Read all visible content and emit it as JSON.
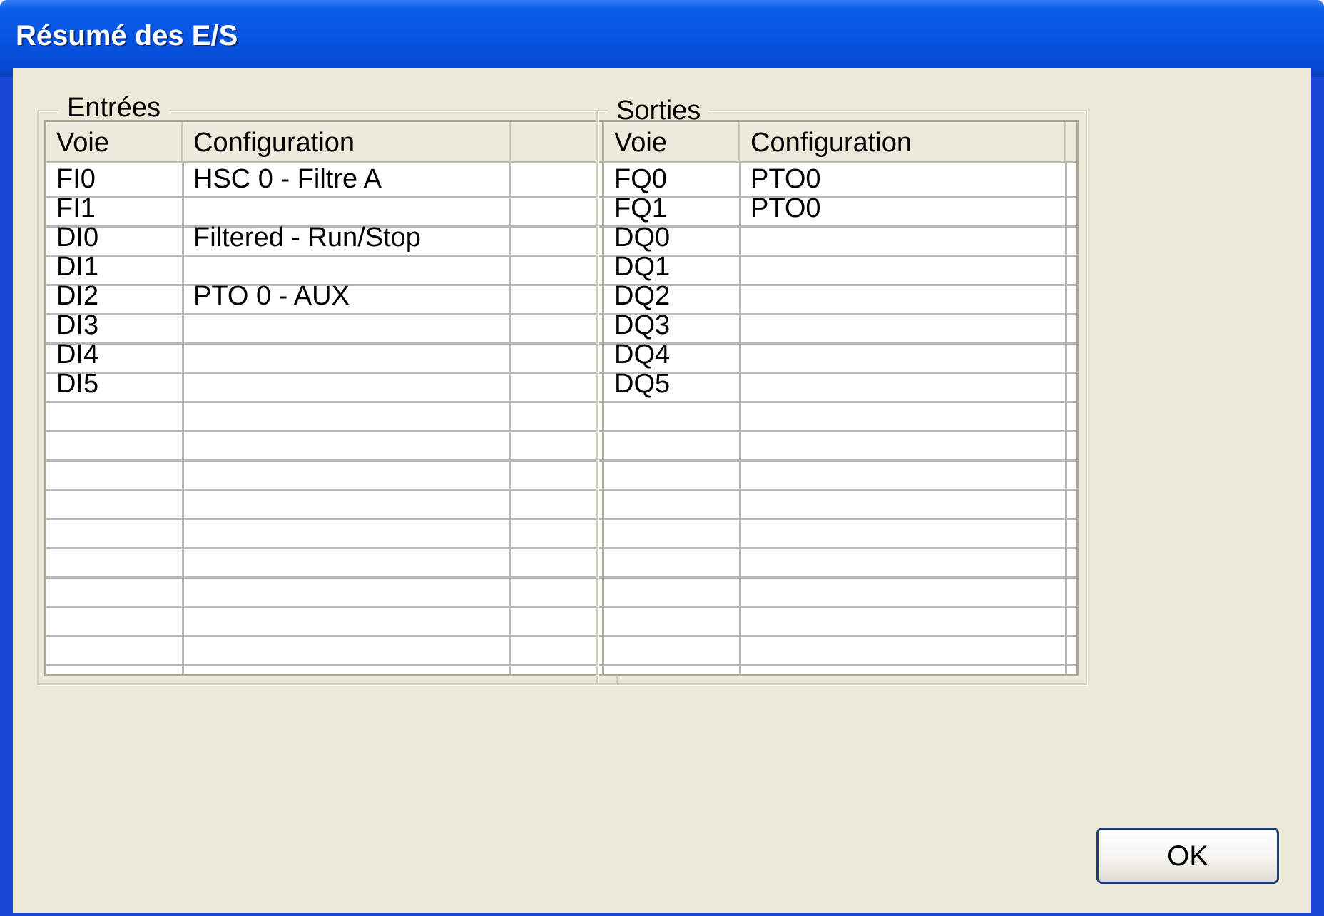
{
  "window": {
    "title": "Résumé des E/S"
  },
  "inputs": {
    "legend": "Entrées",
    "columns": [
      "Voie",
      "Configuration"
    ],
    "rows": [
      {
        "voie": "FI0",
        "config": "HSC 0 - Filtre A"
      },
      {
        "voie": "FI1",
        "config": ""
      },
      {
        "voie": "DI0",
        "config": "Filtered - Run/Stop"
      },
      {
        "voie": "DI1",
        "config": ""
      },
      {
        "voie": "DI2",
        "config": "PTO 0 - AUX"
      },
      {
        "voie": "DI3",
        "config": ""
      },
      {
        "voie": "DI4",
        "config": ""
      },
      {
        "voie": "DI5",
        "config": ""
      },
      {
        "voie": "",
        "config": ""
      },
      {
        "voie": "",
        "config": ""
      },
      {
        "voie": "",
        "config": ""
      },
      {
        "voie": "",
        "config": ""
      },
      {
        "voie": "",
        "config": ""
      },
      {
        "voie": "",
        "config": ""
      },
      {
        "voie": "",
        "config": ""
      },
      {
        "voie": "",
        "config": ""
      },
      {
        "voie": "",
        "config": ""
      }
    ]
  },
  "outputs": {
    "legend": "Sorties",
    "columns": [
      "Voie",
      "Configuration"
    ],
    "rows": [
      {
        "voie": "FQ0",
        "config": "PTO0"
      },
      {
        "voie": "FQ1",
        "config": "PTO0"
      },
      {
        "voie": "DQ0",
        "config": ""
      },
      {
        "voie": "DQ1",
        "config": ""
      },
      {
        "voie": "DQ2",
        "config": ""
      },
      {
        "voie": "DQ3",
        "config": ""
      },
      {
        "voie": "DQ4",
        "config": ""
      },
      {
        "voie": "DQ5",
        "config": ""
      },
      {
        "voie": "",
        "config": ""
      },
      {
        "voie": "",
        "config": ""
      },
      {
        "voie": "",
        "config": ""
      },
      {
        "voie": "",
        "config": ""
      },
      {
        "voie": "",
        "config": ""
      },
      {
        "voie": "",
        "config": ""
      },
      {
        "voie": "",
        "config": ""
      },
      {
        "voie": "",
        "config": ""
      },
      {
        "voie": "",
        "config": ""
      }
    ]
  },
  "buttons": {
    "ok": "OK"
  }
}
